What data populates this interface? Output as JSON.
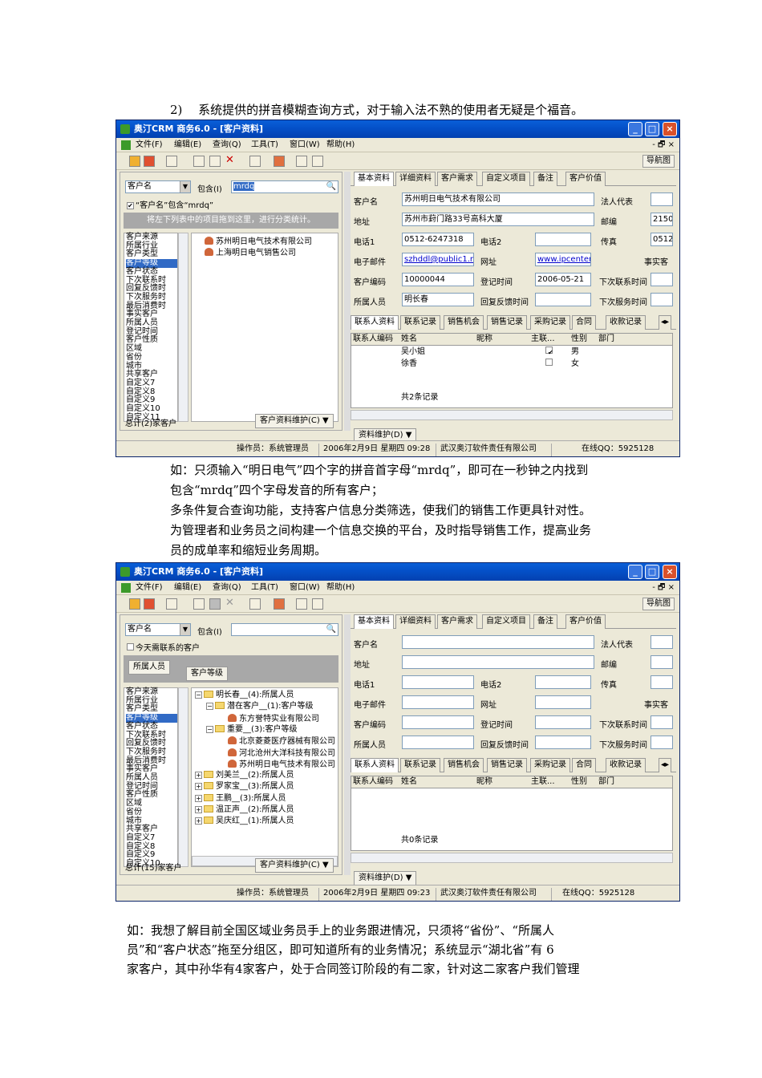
{
  "paragraphs": {
    "p1": "2)　 系统提供的拼音模糊查询方式，对于输入法不熟的使用者无疑是个福音。",
    "p2a": "如：只须输入“明日电气”四个字的拼音首字母“mrdq”，即可在一秒钟之内找到",
    "p2b": "包含“mrdq”四个字母发音的所有客户；",
    "p3a": " 多条件复合查询功能，支持客户信息分类筛选，使我们的销售工作更具针对性。",
    "p3b": "为管理者和业务员之间构建一个信息交换的平台，及时指导销售工作，提高业务",
    "p3c": "员的成单率和缩短业务周期。",
    "p4a": "如：我想了解目前全国区域业务员手上的业务跟进情况，只须将“省份”、“所属人",
    "p4b": "员”和“客户状态”拖至分组区，即可知道所有的业务情况；系统显示“湖北省”有 6",
    "p4c": "家客户，其中孙华有4家客户，处于合同签订阶段的有二家，针对这二家客户我们管理"
  },
  "window": {
    "title": "奥汀CRM  商务6.0 - [客户资料]",
    "menu": [
      "文件(F)",
      "编辑(E)",
      "查询(Q)",
      "工具(T)",
      "窗口(W)",
      "帮助(H)"
    ],
    "nav_label": "导航图",
    "min_glyph": "_",
    "max_glyph": "□",
    "close_glyph": "×",
    "mdi_controls": "- 🗗 ×"
  },
  "search": {
    "field": "客户名",
    "op": "包含(I)",
    "value1": "mrdq",
    "value2": "",
    "check1": "“客户名”包含“mrdq”",
    "check2": "今天需联系的客户",
    "group_hint": "将左下列表中的项目拖到这里，进行分类统计。",
    "group_chip": "所属人员",
    "group_chip2": "客户等级"
  },
  "categories": [
    "客户来源",
    "所属行业",
    "客户类型",
    "客户等级",
    "客户状态",
    "下次联系时",
    "回复反馈时",
    "下次服务时",
    "最后消费时",
    "事实客户",
    "所属人员",
    "登记时间",
    "客户性质",
    "区域",
    "省份",
    "城市",
    "共享客户",
    "自定义7",
    "自定义8",
    "自定义9",
    "自定义10",
    "自定义11"
  ],
  "categories2": [
    "客户来源",
    "所属行业",
    "客户类型",
    "客户等级",
    "客户状态",
    "下次联系时",
    "回复反馈时",
    "下次服务时",
    "最后消费时",
    "事实客户",
    "所属人员",
    "登记时间",
    "客户性质",
    "区域",
    "省份",
    "城市",
    "共享客户",
    "自定义7",
    "自定义8",
    "自定义9",
    "自定义10"
  ],
  "selected_category": "客户等级",
  "tree1": [
    "苏州明日电气技术有限公司",
    "上海明日电气销售公司"
  ],
  "tree2": [
    {
      "t": "明长春__(4):所属人员",
      "lvl": 0,
      "k": "folder",
      "exp": "−"
    },
    {
      "t": "潜在客户__(1):客户等级",
      "lvl": 1,
      "k": "folder",
      "exp": "−"
    },
    {
      "t": "东方誉特实业有限公司",
      "lvl": 2,
      "k": "people",
      "exp": ""
    },
    {
      "t": "重要__(3):客户等级",
      "lvl": 1,
      "k": "folder",
      "exp": "−"
    },
    {
      "t": "北京菱菱医疗器械有限公司",
      "lvl": 2,
      "k": "people",
      "exp": ""
    },
    {
      "t": "河北沧州大洋科技有限公司",
      "lvl": 2,
      "k": "people",
      "exp": ""
    },
    {
      "t": "苏州明日电气技术有限公司",
      "lvl": 2,
      "k": "people",
      "exp": ""
    },
    {
      "t": "刘美兰__(2):所属人员",
      "lvl": 0,
      "k": "folder",
      "exp": "+"
    },
    {
      "t": "罗家宝__(3):所属人员",
      "lvl": 0,
      "k": "folder",
      "exp": "+"
    },
    {
      "t": "王鹏__(3):所属人员",
      "lvl": 0,
      "k": "folder",
      "exp": "+"
    },
    {
      "t": "温正声__(2):所属人员",
      "lvl": 0,
      "k": "folder",
      "exp": "+"
    },
    {
      "t": "吴庆红__(1):所属人员",
      "lvl": 0,
      "k": "folder",
      "exp": "+"
    }
  ],
  "total1": "总计(2)家客户",
  "total2": "总计(15)家客户",
  "maint_btn": "客户资料维护(C)",
  "data_btn": "资料维护(D)",
  "tabs_top": [
    "基本资料",
    "详细资料",
    "客户需求",
    "自定义项目",
    "备注",
    "客户价值"
  ],
  "tabs_bottom": [
    "联系人资料",
    "联系记录",
    "销售机会",
    "销售记录",
    "采购记录",
    "合同",
    "收款记录"
  ],
  "labels": {
    "name": "客户名",
    "legal": "法人代表",
    "addr": "地址",
    "zip": "邮编",
    "tel1": "电话1",
    "tel2": "电话2",
    "fax": "传真",
    "email": "电子邮件",
    "web": "网址",
    "fact": "事实客",
    "code": "客户编码",
    "regtime": "登记时间",
    "nextcontact": "下次联系时间",
    "owner": "所属人员",
    "reply": "回复反馈时间",
    "nextservice": "下次服务时间"
  },
  "record1": {
    "name": "苏州明日电气技术有限公司",
    "addr": "苏州市葑门路33号高科大厦",
    "zip": "2150",
    "tel1": "0512-6247318",
    "fax": "0512",
    "email": "szhddl@public1.ne",
    "web": "www.ipcenter.com",
    "code": "10000044",
    "regtime": "2006-05-21",
    "owner": "明长春"
  },
  "grid_cols": [
    "联系人编码",
    "姓名",
    "昵称",
    "主联...",
    "性别",
    "部门"
  ],
  "contacts1": [
    {
      "name": "吴小姐",
      "main": "✔",
      "sex": "男"
    },
    {
      "name": "徐香",
      "main": "",
      "sex": "女"
    }
  ],
  "count1": "共2条记录",
  "count2": "共0条记录",
  "status1": {
    "op": "操作员：系统管理员",
    "date": "2006年2月9日  星期四 09:28",
    "company": "武汉奥汀软件责任有限公司",
    "qq": "在线QQ：5925128"
  },
  "status2": {
    "op": "操作员：系统管理员",
    "date": "2006年2月9日  星期四 09:23",
    "company": "武汉奥汀软件责任有限公司",
    "qq": "在线QQ：5925128"
  },
  "colors": {
    "title_bar": "#0450c8",
    "selection": "#316ac5",
    "chrome": "#ece9d8"
  }
}
